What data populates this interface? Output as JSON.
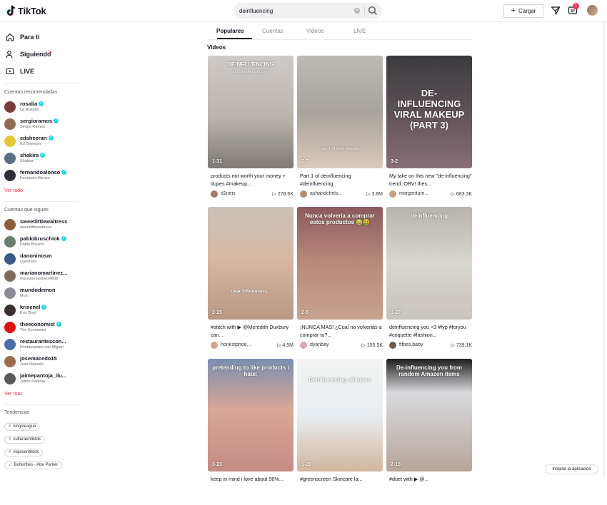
{
  "header": {
    "brand": "TikTok",
    "search_value": "deinfluencing",
    "upload_label": "Cargar",
    "inbox_badge": "1"
  },
  "sidebar": {
    "nav": [
      {
        "label": "Para ti",
        "icon": "home-icon"
      },
      {
        "label": "Siguiendo",
        "icon": "following-icon"
      },
      {
        "label": "LIVE",
        "icon": "live-icon"
      }
    ],
    "recommended_title": "Cuentas recomendadas",
    "recommended": [
      {
        "user": "rosalia",
        "name": "La Rosalía",
        "verified": true,
        "color": "#7a3b3b"
      },
      {
        "user": "sergioramos",
        "name": "Sergio Ramos",
        "verified": true,
        "color": "#8f6a52"
      },
      {
        "user": "edsheeran",
        "name": "Ed Sheeran",
        "verified": true,
        "color": "#e5c53a"
      },
      {
        "user": "shakira",
        "name": "Shakira",
        "verified": true,
        "color": "#5b6f86"
      },
      {
        "user": "fernandoalonso",
        "name": "Fernando Alonso",
        "verified": true,
        "color": "#2d2f36"
      }
    ],
    "see_all": "Ver todo",
    "following_title": "Cuentas que sigues",
    "following": [
      {
        "user": "sweetlittlewaitress",
        "name": "sweetlittlewaitress",
        "verified": false,
        "color": "#8a5e3c"
      },
      {
        "user": "pablobruschiok",
        "name": "Pablo Bruschi",
        "verified": true,
        "color": "#6a7d6a"
      },
      {
        "user": "danoninosm",
        "name": "Danonino",
        "verified": false,
        "color": "#3d5a88"
      },
      {
        "user": "marianomartinez...",
        "name": "marianomartinez4808",
        "verified": false,
        "color": "#7b6b5a"
      },
      {
        "user": "mundodemon",
        "name": "Mon",
        "verified": false,
        "color": "#8c8c96"
      },
      {
        "user": "krisenel",
        "name": "Kris Onel",
        "verified": true,
        "color": "#3b2f2f"
      },
      {
        "user": "theeconomist",
        "name": "The Economist",
        "verified": true,
        "color": "#e3120b"
      },
      {
        "user": "restaurantescon...",
        "name": "Restaurantes con Miguel",
        "verified": false,
        "color": "#4a6fa8"
      },
      {
        "user": "josemacedo15",
        "name": "Jose Macedo",
        "verified": false,
        "color": "#9a6b4f"
      },
      {
        "user": "jaimepantoja_ilu...",
        "name": "Jaime Pantoja",
        "verified": false,
        "color": "#5a5a5a"
      }
    ],
    "see_more": "Ver más",
    "trends_title": "Tendencias",
    "trends": [
      {
        "label": "kingsleague",
        "icon": "#"
      },
      {
        "label": "culturaentiktok",
        "icon": "#"
      },
      {
        "label": "viajesentiktok",
        "icon": "#"
      },
      {
        "label": "Butterflies - Abe Parker",
        "icon": "♫"
      }
    ]
  },
  "tabs": [
    "Populares",
    "Cuentas",
    "Videos",
    "LIVE"
  ],
  "section_label": "Videos",
  "videos": [
    {
      "overlay": "DEINFLUENCING",
      "sub": "pa 5 makeup dupes",
      "date": "1-31",
      "caption": "products not worth your money + dupes #makeup...",
      "user": "d1neis",
      "plays": "278.6K",
      "bg": "linear-gradient(180deg,#cfcac6 0%,#b9b3ad 55%,#7f7a75 100%)",
      "av": "#a07a6a"
    },
    {
      "overlay": "",
      "sub": "part 1 of deinfluencing",
      "date": "2-7",
      "caption": "Part 1 of deinfluencing #deinfluencing",
      "user": "ashandchels...",
      "plays": "3.8M",
      "bg": "linear-gradient(180deg,#bdbab5 0%,#a8a39c 50%,#d8c9bd 100%)",
      "av": "#b68a6e"
    },
    {
      "overlay": "DE-INFLUENCING VIRAL MAKEUP (PART 3)",
      "sub": "",
      "date": "3-2",
      "caption": "My take on this new \"de-influencing\" trend. OBV! thes...",
      "user": "morgentum...",
      "plays": "683.3K",
      "bg": "linear-gradient(180deg,#3b3b3e 0%,#5a4f55 45%,#8a6e78 100%)",
      "av": "#c8a07c"
    },
    {
      "overlay": "Dear influencers...",
      "sub": "",
      "date": "2-25",
      "caption": "#stitch with ▶ @Meredith Duxbury can...",
      "user": "honestphoe...",
      "plays": "4.5M",
      "bg": "linear-gradient(180deg,#c9c2b8 0%,#d8b8a2 45%,#b99884 100%)",
      "av": "#d0a585"
    },
    {
      "overlay": "Nunca volvería a comprar estos productos 🤢🤮",
      "sub": "",
      "date": "2-5",
      "caption": "¡NUNCA MAS! ¿Cual no volverias a comprar tu?...",
      "user": "dyanbay",
      "plays": "155.5K",
      "bg": "linear-gradient(180deg,#8c5a5f 0%,#b98a7a 50%,#c7a38e 100%)",
      "av": "#d9a7b4"
    },
    {
      "overlay": "deinfluencing",
      "sub": "",
      "date": "3-27",
      "caption": "deinfluencing you <3 #fyp #foryou #coquette #fashion...",
      "user": "fifties.baby",
      "plays": "739.1K",
      "bg": "linear-gradient(180deg,#b8b4ad 0%,#d9d6d0 50%,#c8c3bb 100%)",
      "av": "#6d5d4f"
    },
    {
      "overlay": "pretending to like products i hate:",
      "sub": "",
      "date": "3-23",
      "caption": "keep in mind i love about 90%...",
      "user": "",
      "plays": "",
      "bg": "linear-gradient(180deg,#7b8fb1 0%,#d8a796 45%,#c58b83 100%)",
      "av": "#c58b83"
    },
    {
      "overlay": "Deinfluencing skincare",
      "sub": "",
      "date": "1-28",
      "caption": "#greenscreen Skincare la...",
      "user": "",
      "plays": "",
      "bg": "linear-gradient(180deg,#f2f2f2 0%,#e8eef2 50%,#d3b59c 100%)",
      "av": "#9b7d6a"
    },
    {
      "overlay": "De-influencing you from random Amazon items",
      "sub": "",
      "date": "2-15",
      "caption": "#duet with ▶ @...",
      "user": "",
      "plays": "",
      "bg": "linear-gradient(180deg,#1d1d1f 0%,#d9d9dd 30%,#b5a59a 100%)",
      "av": "#777"
    }
  ],
  "install_label": "Instalar la aplicación"
}
